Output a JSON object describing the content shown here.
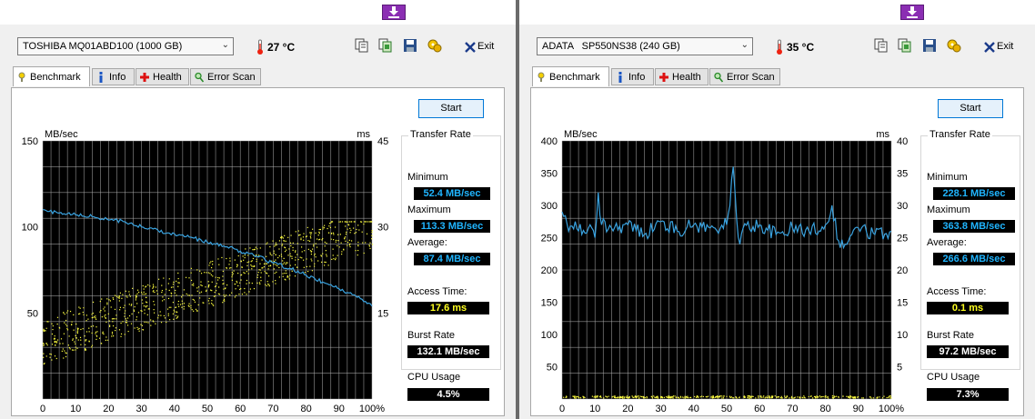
{
  "panels": [
    {
      "drive": "TOSHIBA MQ01ABD100 (1000 GB)",
      "temperature": "27 °C",
      "exit_label": "Exit",
      "tabs": [
        "Benchmark",
        "Info",
        "Health",
        "Error Scan"
      ],
      "start_label": "Start",
      "transfer_rate_title": "Transfer Rate",
      "minimum_label": "Minimum",
      "minimum": "52.4 MB/sec",
      "maximum_label": "Maximum",
      "maximum": "113.3 MB/sec",
      "average_label": "Average:",
      "average": "87.4 MB/sec",
      "access_time_label": "Access Time:",
      "access_time": "17.6 ms",
      "burst_rate_label": "Burst Rate",
      "burst_rate": "132.1 MB/sec",
      "cpu_usage_label": "CPU Usage",
      "cpu_usage": "4.5%"
    },
    {
      "drive": "ADATA   SP550NS38 (240 GB)",
      "temperature": "35 °C",
      "exit_label": "Exit",
      "tabs": [
        "Benchmark",
        "Info",
        "Health",
        "Error Scan"
      ],
      "start_label": "Start",
      "transfer_rate_title": "Transfer Rate",
      "minimum_label": "Minimum",
      "minimum": "228.1 MB/sec",
      "maximum_label": "Maximum",
      "maximum": "363.8 MB/sec",
      "average_label": "Average:",
      "average": "266.6 MB/sec",
      "access_time_label": "Access Time:",
      "access_time": "0.1 ms",
      "burst_rate_label": "Burst Rate",
      "burst_rate": "97.2 MB/sec",
      "cpu_usage_label": "CPU Usage",
      "cpu_usage": "7.3%"
    }
  ],
  "colors": {
    "transfer_line": "#3aa3e0",
    "access_points": "#ffff40",
    "grid": "#b0b0b0",
    "plot_bg": "#000000",
    "value_cyan": "#20b5ff",
    "value_yellow": "#ffff20"
  },
  "chart_data": [
    {
      "type": "line",
      "left_unit": "MB/sec",
      "right_unit": "ms",
      "ylim": [
        0,
        150
      ],
      "y2lim": [
        0,
        45
      ],
      "y_ticks": [
        "150",
        "100",
        "50"
      ],
      "y2_ticks": [
        "45",
        "30",
        "15"
      ],
      "x_ticks": [
        "0",
        "10",
        "20",
        "30",
        "40",
        "50",
        "60",
        "70",
        "80",
        "90",
        "100%"
      ],
      "series": [
        {
          "kind": "transfer-rate-line",
          "x": [
            0,
            2,
            5,
            10,
            15,
            20,
            25,
            30,
            35,
            40,
            45,
            50,
            55,
            60,
            65,
            70,
            75,
            80,
            85,
            90,
            95,
            100
          ],
          "values": [
            110,
            109,
            108,
            107,
            106,
            104,
            103,
            100,
            98,
            96,
            94,
            91,
            89,
            86,
            83,
            79,
            76,
            72,
            68,
            64,
            60,
            54
          ]
        },
        {
          "kind": "access-time-scatter",
          "description_range_ms": [
            3,
            30
          ]
        }
      ]
    },
    {
      "type": "line",
      "left_unit": "MB/sec",
      "right_unit": "ms",
      "ylim": [
        0,
        400
      ],
      "y2lim": [
        0,
        40
      ],
      "y_ticks": [
        "400",
        "350",
        "300",
        "250",
        "200",
        "150",
        "100",
        "50"
      ],
      "y2_ticks": [
        "40",
        "35",
        "30",
        "25",
        "20",
        "15",
        "10",
        "5"
      ],
      "x_ticks": [
        "0",
        "10",
        "20",
        "30",
        "40",
        "50",
        "60",
        "70",
        "80",
        "90",
        "100%"
      ],
      "series": [
        {
          "kind": "transfer-rate-line",
          "x": [
            0,
            2,
            4,
            6,
            8,
            10,
            11,
            12,
            15,
            20,
            25,
            30,
            35,
            40,
            45,
            50,
            51,
            52,
            53,
            54,
            55,
            60,
            65,
            70,
            75,
            80,
            82,
            84,
            86,
            88,
            90,
            95,
            100
          ],
          "values": [
            290,
            260,
            275,
            255,
            265,
            250,
            320,
            270,
            265,
            270,
            255,
            275,
            260,
            270,
            265,
            270,
            300,
            360,
            280,
            240,
            265,
            270,
            255,
            265,
            260,
            270,
            300,
            245,
            240,
            255,
            265,
            255,
            260
          ]
        },
        {
          "kind": "access-time-scatter",
          "description_range_ms": [
            0,
            0.5
          ]
        }
      ]
    }
  ]
}
